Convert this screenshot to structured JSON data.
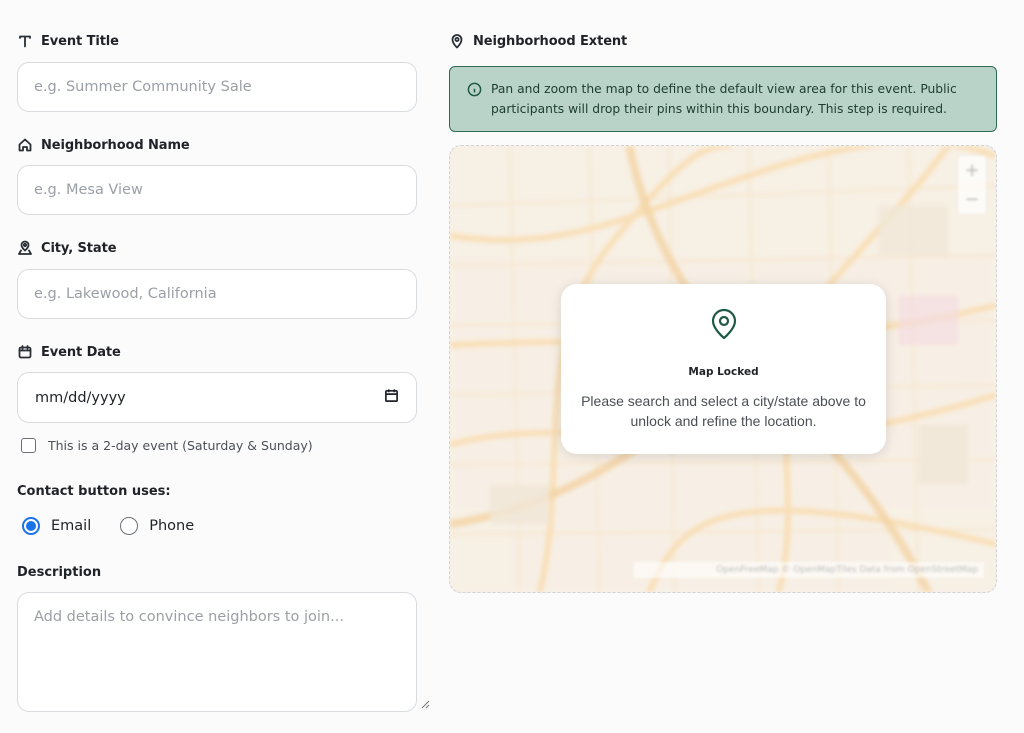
{
  "form": {
    "event_title": {
      "label": "Event Title",
      "placeholder": "e.g. Summer Community Sale"
    },
    "neighborhood_name": {
      "label": "Neighborhood Name",
      "placeholder": "e.g. Mesa View"
    },
    "city_state": {
      "label": "City, State",
      "placeholder": "e.g. Lakewood, California"
    },
    "event_date": {
      "label": "Event Date",
      "value": "mm/dd/yyyy"
    },
    "two_day": {
      "label": "This is a 2-day event (Saturday & Sunday)",
      "checked": false
    },
    "contact": {
      "label": "Contact button uses:",
      "options": [
        {
          "label": "Email",
          "selected": true
        },
        {
          "label": "Phone",
          "selected": false
        }
      ]
    },
    "description": {
      "label": "Description",
      "placeholder": "Add details to convince neighbors to join..."
    }
  },
  "extent": {
    "label": "Neighborhood Extent",
    "info": "Pan and zoom the map to define the default view area for this event. Public participants will drop their pins within this boundary. This step is required.",
    "map": {
      "locked_title": "Map Locked",
      "locked_message": "Please search and select a city/state above to unlock and refine the location.",
      "zoom_in": "+",
      "zoom_out": "−",
      "attribution": "OpenFreeMap © OpenMapTiles Data from OpenStreetMap"
    }
  },
  "colors": {
    "accent_green": "#1f5a45",
    "info_bg": "#b9d3c9",
    "radio_blue": "#1a73e8"
  }
}
